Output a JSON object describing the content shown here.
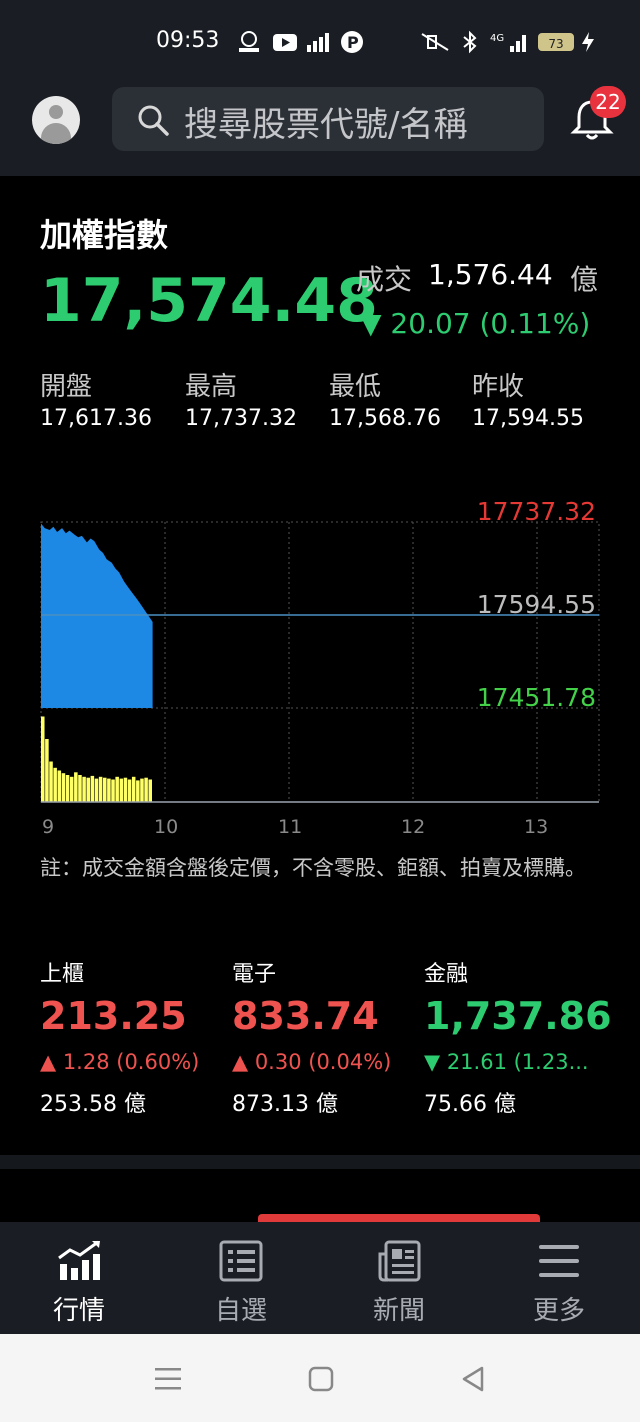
{
  "status_bar": {
    "time": "09:53",
    "icons": [
      "gomaji-icon",
      "youtube-icon",
      "signal-bars-icon",
      "parking-icon",
      "mute-icon",
      "bluetooth-icon",
      "cellular-4g-icon",
      "charging-icon"
    ],
    "network": "4G",
    "battery": "73"
  },
  "header": {
    "search_placeholder": "搜尋股票代號/名稱",
    "notification_count": "22"
  },
  "index": {
    "name": "加權指數",
    "value": "17,574.48",
    "volume_label": "成交",
    "volume_value": "1,576.44",
    "volume_unit": "億",
    "change": "▼ 20.07 (0.11%)",
    "ohlc": [
      {
        "label": "開盤",
        "value": "17,617.36"
      },
      {
        "label": "最高",
        "value": "17,737.32"
      },
      {
        "label": "最低",
        "value": "17,568.76"
      },
      {
        "label": "昨收",
        "value": "17,594.55"
      }
    ]
  },
  "chart_data": {
    "type": "area",
    "y_labels": {
      "high": "17737.32",
      "prev_close": "17594.55",
      "low": "17451.78"
    },
    "ylim": [
      17451.78,
      17737.32
    ],
    "x_ticks": [
      "9",
      "10",
      "11",
      "12",
      "13"
    ],
    "colors": {
      "price": "#1e88e5",
      "volume": "#ffff66",
      "high_label": "#e53935",
      "mid_label": "#bdbdbd",
      "low_label": "#43d14a"
    },
    "price_series": [
      {
        "t": 9.0,
        "y": 17735
      },
      {
        "t": 9.03,
        "y": 17728
      },
      {
        "t": 9.07,
        "y": 17725
      },
      {
        "t": 9.1,
        "y": 17730
      },
      {
        "t": 9.13,
        "y": 17722
      },
      {
        "t": 9.17,
        "y": 17728
      },
      {
        "t": 9.2,
        "y": 17720
      },
      {
        "t": 9.23,
        "y": 17724
      },
      {
        "t": 9.27,
        "y": 17718
      },
      {
        "t": 9.3,
        "y": 17714
      },
      {
        "t": 9.33,
        "y": 17716
      },
      {
        "t": 9.37,
        "y": 17706
      },
      {
        "t": 9.4,
        "y": 17712
      },
      {
        "t": 9.43,
        "y": 17708
      },
      {
        "t": 9.47,
        "y": 17695
      },
      {
        "t": 9.5,
        "y": 17690
      },
      {
        "t": 9.53,
        "y": 17680
      },
      {
        "t": 9.57,
        "y": 17675
      },
      {
        "t": 9.6,
        "y": 17666
      },
      {
        "t": 9.63,
        "y": 17660
      },
      {
        "t": 9.67,
        "y": 17646
      },
      {
        "t": 9.7,
        "y": 17638
      },
      {
        "t": 9.73,
        "y": 17630
      },
      {
        "t": 9.77,
        "y": 17620
      },
      {
        "t": 9.8,
        "y": 17612
      },
      {
        "t": 9.85,
        "y": 17598
      },
      {
        "t": 9.9,
        "y": 17584
      }
    ],
    "volume_series": [
      95,
      70,
      45,
      38,
      35,
      32,
      30,
      28,
      33,
      30,
      28,
      27,
      29,
      26,
      28,
      27,
      26,
      25,
      28,
      26,
      27,
      25,
      28,
      24,
      26,
      27,
      25
    ]
  },
  "footnote": "註：成交金額含盤後定價，不含零股、鉅額、拍賣及標購。",
  "sub_indices": [
    {
      "name": "上櫃",
      "value": "213.25",
      "change": "▲ 1.28 (0.60%)",
      "amount": "253.58 億",
      "direction": "up"
    },
    {
      "name": "電子",
      "value": "833.74",
      "change": "▲ 0.30 (0.04%)",
      "amount": "873.13 億",
      "direction": "up"
    },
    {
      "name": "金融",
      "value": "1,737.86",
      "change": "▼ 21.61 (1.23...",
      "amount": "75.66 億",
      "direction": "down"
    }
  ],
  "bottom_nav": [
    {
      "label": "行情",
      "icon": "chart-trend-icon",
      "active": true
    },
    {
      "label": "自選",
      "icon": "list-icon",
      "active": false
    },
    {
      "label": "新聞",
      "icon": "newspaper-icon",
      "active": false
    },
    {
      "label": "更多",
      "icon": "menu-icon",
      "active": false
    }
  ]
}
